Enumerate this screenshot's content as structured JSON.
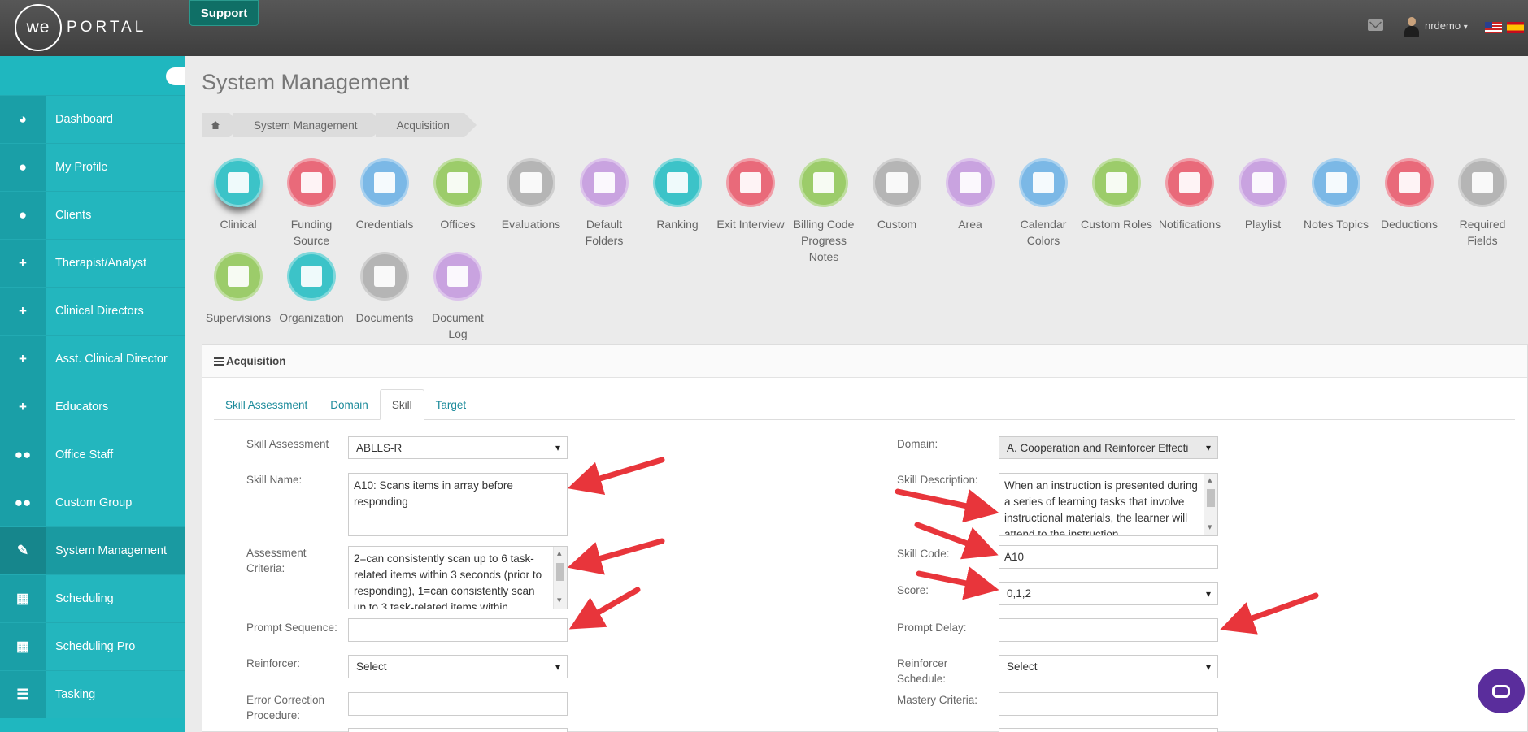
{
  "header": {
    "logo_text": "we",
    "logo_word": "PORTAL",
    "support_label": "Support",
    "user_name": "nrdemo",
    "user_caret": "▾"
  },
  "sidebar": {
    "items": [
      {
        "label": "Dashboard",
        "icon": "dashboard-icon",
        "glyph": "◕"
      },
      {
        "label": "My Profile",
        "icon": "user-icon",
        "glyph": "●"
      },
      {
        "label": "Clients",
        "icon": "user-icon",
        "glyph": "●"
      },
      {
        "label": "Therapist/Analyst",
        "icon": "plus-icon",
        "glyph": "+"
      },
      {
        "label": "Clinical Directors",
        "icon": "plus-icon",
        "glyph": "+"
      },
      {
        "label": "Asst. Clinical Director",
        "icon": "plus-icon",
        "glyph": "+"
      },
      {
        "label": "Educators",
        "icon": "plus-icon",
        "glyph": "+"
      },
      {
        "label": "Office Staff",
        "icon": "users-icon",
        "glyph": "●●"
      },
      {
        "label": "Custom Group",
        "icon": "users-icon",
        "glyph": "●●"
      },
      {
        "label": "System Management",
        "icon": "wrench-icon",
        "glyph": "✎"
      },
      {
        "label": "Scheduling",
        "icon": "calendar-icon",
        "glyph": "▦"
      },
      {
        "label": "Scheduling Pro",
        "icon": "calendar-icon",
        "glyph": "▦"
      },
      {
        "label": "Tasking",
        "icon": "list-icon",
        "glyph": "☰"
      }
    ],
    "active_index": 9
  },
  "page": {
    "title": "System Management",
    "breadcrumb": [
      "System Management",
      "Acquisition"
    ]
  },
  "tiles": [
    {
      "label": "Clinical",
      "color": "#3cc3c8",
      "icon": "plus-icon",
      "selected": true
    },
    {
      "label": "Funding Source",
      "color": "#e96a7a",
      "icon": "book-icon"
    },
    {
      "label": "Credentials",
      "color": "#7bb8e6",
      "icon": "book-icon"
    },
    {
      "label": "Offices",
      "color": "#9ccc6a",
      "icon": "building-icon"
    },
    {
      "label": "Evaluations",
      "color": "#b5b5b5",
      "icon": "gear-icon"
    },
    {
      "label": "Default Folders",
      "color": "#c9a3e0",
      "icon": "folder-icon"
    },
    {
      "label": "Ranking",
      "color": "#3cc3c8",
      "icon": "bar-chart-icon"
    },
    {
      "label": "Exit Interview",
      "color": "#e96a7a",
      "icon": "checkbox-icon"
    },
    {
      "label": "Billing Code Progress Notes",
      "color": "#9ccc6a",
      "icon": "book-icon"
    },
    {
      "label": "Custom",
      "color": "#b5b5b5",
      "icon": "gear-icon"
    },
    {
      "label": "Area",
      "color": "#c9a3e0",
      "icon": "building-icon"
    },
    {
      "label": "Calendar Colors",
      "color": "#7bb8e6",
      "icon": "calendar-icon"
    },
    {
      "label": "Custom Roles",
      "color": "#9ccc6a",
      "icon": "users-icon"
    },
    {
      "label": "Notifications",
      "color": "#e96a7a",
      "icon": "bell-icon"
    },
    {
      "label": "Playlist",
      "color": "#c9a3e0",
      "icon": "play-icon"
    },
    {
      "label": "Notes Topics",
      "color": "#7bb8e6",
      "icon": "list-icon"
    },
    {
      "label": "Deductions",
      "color": "#e96a7a",
      "icon": "minus-circle-icon"
    },
    {
      "label": "Required Fields",
      "color": "#b5b5b5",
      "icon": "exclamation-icon"
    },
    {
      "label": "Supervisions",
      "color": "#9ccc6a",
      "icon": "sitemap-icon"
    },
    {
      "label": "Organization",
      "color": "#3cc3c8",
      "icon": "hospital-icon"
    },
    {
      "label": "Documents",
      "color": "#b5b5b5",
      "icon": "list-icon"
    },
    {
      "label": "Document Log",
      "color": "#c9a3e0",
      "icon": "list-outdent-icon"
    }
  ],
  "panel": {
    "title": "Acquisition",
    "tabs": [
      "Skill Assessment",
      "Domain",
      "Skill",
      "Target"
    ],
    "active_tab": 2
  },
  "form": {
    "skill_assessment_label": "Skill Assessment",
    "skill_assessment_value": "ABLLS-R",
    "skill_name_label": "Skill Name:",
    "skill_name_value": "A10: Scans items in array before responding",
    "assessment_criteria_label": "Assessment Criteria:",
    "assessment_criteria_value": "2=can consistently scan up to 6 task-related items within 3 seconds (prior to responding), 1=can consistently scan up to 3 task-related items within",
    "prompt_sequence_label": "Prompt Sequence:",
    "prompt_sequence_value": "",
    "reinforcer_label": "Reinforcer:",
    "reinforcer_value": "Select",
    "error_correction_label": "Error Correction Procedure:",
    "error_correction_value": "",
    "domain_label": "Domain:",
    "domain_value": "A. Cooperation and Reinforcer Effecti",
    "skill_description_label": "Skill Description:",
    "skill_description_value": "When an instruction is presented during a series of learning tasks that involve instructional materials, the learner will attend to the instruction",
    "skill_code_label": "Skill Code:",
    "skill_code_value": "A10",
    "score_label": "Score:",
    "score_value": "0,1,2",
    "prompt_delay_label": "Prompt Delay:",
    "prompt_delay_value": "",
    "reinforcer_schedule_label": "Reinforcer Schedule:",
    "reinforcer_schedule_value": "Select",
    "mastery_criteria_label": "Mastery Criteria:",
    "mastery_criteria_value": ""
  },
  "colors": {
    "arrow": "#e8353b",
    "accent": "#1fb7bf",
    "chat": "#5a2d9c"
  }
}
